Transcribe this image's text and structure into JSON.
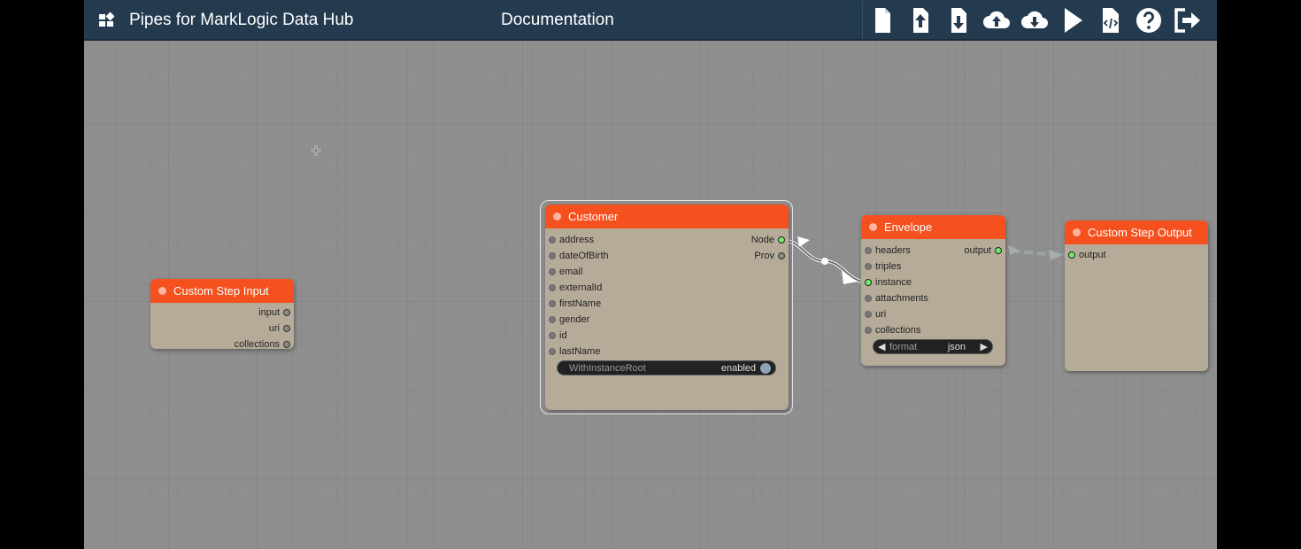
{
  "header": {
    "app_title": "Pipes for MarkLogic Data Hub",
    "doc_link": "Documentation",
    "toolbar_icons": [
      "new-file-icon",
      "upload-file-icon",
      "download-file-icon",
      "cloud-upload-icon",
      "cloud-download-icon",
      "play-icon",
      "code-file-icon",
      "help-icon",
      "logout-icon"
    ]
  },
  "colors": {
    "header_bg": "#243a4e",
    "canvas_bg": "#8f8f8f",
    "node_title": "#f4511e",
    "node_body": "#b6ab98",
    "connected_pin": "#6cf06c"
  },
  "nodes": {
    "custom_step_input": {
      "title": "Custom Step Input",
      "outputs": [
        "input",
        "uri",
        "collections"
      ]
    },
    "customer": {
      "title": "Customer",
      "inputs": [
        "address",
        "dateOfBirth",
        "email",
        "externalId",
        "firstName",
        "gender",
        "id",
        "lastName"
      ],
      "outputs": [
        "Node",
        "Prov"
      ],
      "widget": {
        "label": "WithInstanceRoot",
        "value": "enabled"
      }
    },
    "envelope": {
      "title": "Envelope",
      "inputs": [
        "headers",
        "triples",
        "instance",
        "attachments",
        "uri",
        "collections"
      ],
      "outputs": [
        "output"
      ],
      "widget": {
        "label": "format",
        "value": "json",
        "prev": "◀",
        "next": "▶"
      }
    },
    "custom_step_output": {
      "title": "Custom Step Output",
      "inputs": [
        "output"
      ]
    }
  }
}
